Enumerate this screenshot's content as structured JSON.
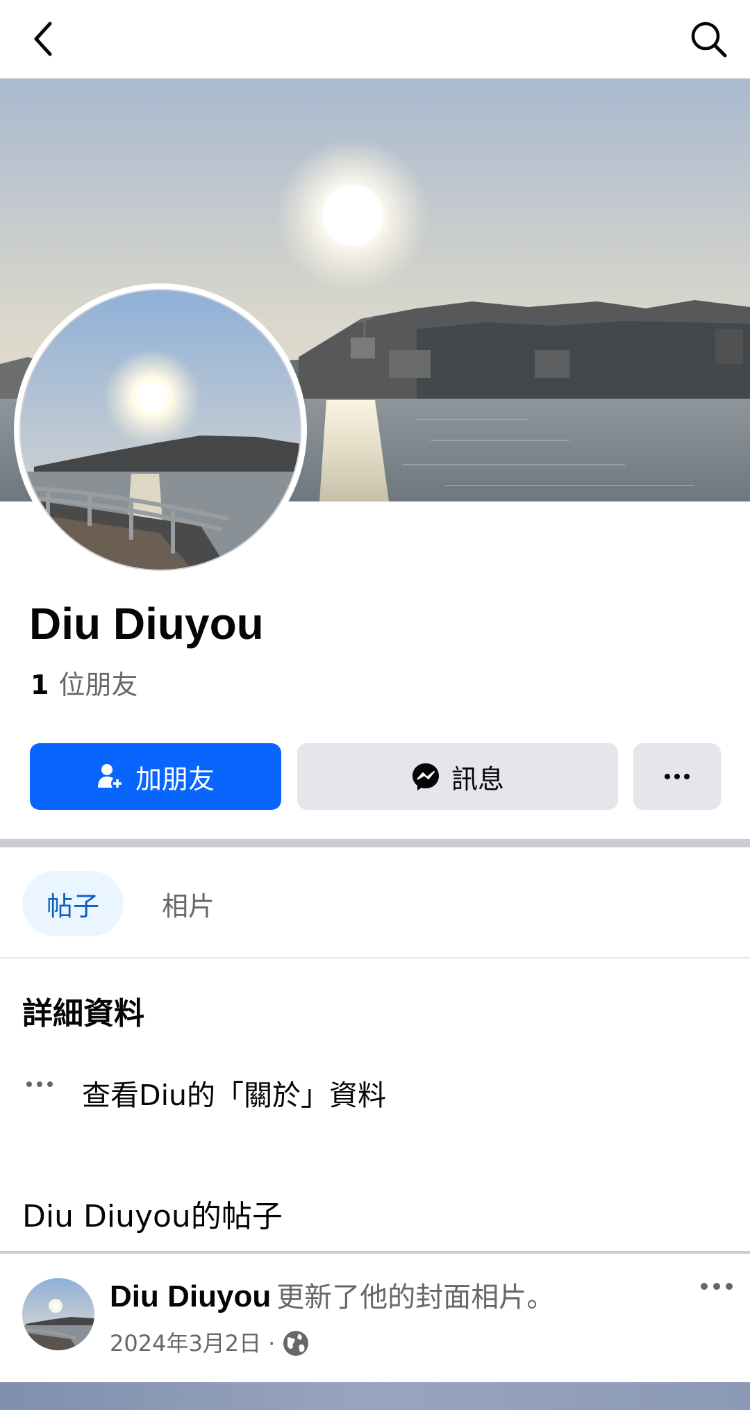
{
  "profile": {
    "name": "Diu Diuyou",
    "friend_count": "1",
    "friend_label": "位朋友"
  },
  "actions": {
    "add_friend_label": "加朋友",
    "message_label": "訊息"
  },
  "tabs": [
    {
      "label": "帖子",
      "selected": true
    },
    {
      "label": "相片",
      "selected": false
    }
  ],
  "details": {
    "title": "詳細資料",
    "about_link": "查看Diu的「關於」資料"
  },
  "posts": {
    "heading": "Diu Diuyou的帖子",
    "items": [
      {
        "author": "Diu Diuyou",
        "action": "更新了他的封面相片。",
        "date": "2024年3月2日",
        "separator": "·",
        "audience_icon": "globe-icon"
      }
    ]
  },
  "colors": {
    "primary": "#0866ff",
    "secondary_button": "#e4e6eb",
    "selected_tab_bg": "#ebf5ff",
    "selected_tab_text": "#0a5fc4",
    "muted_text": "#65676b"
  }
}
